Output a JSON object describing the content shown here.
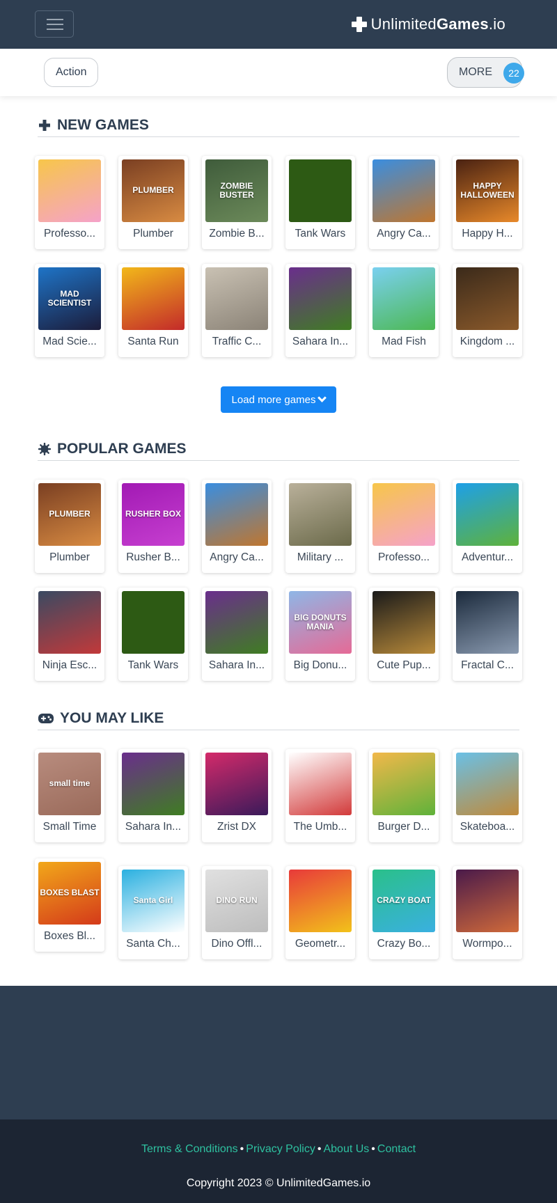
{
  "header": {
    "brand_light": "Unlimited",
    "brand_bold": "Games",
    "brand_suffix": ".io"
  },
  "categories": {
    "active": "Action",
    "more_label": "MORE",
    "more_count": "22"
  },
  "sections": [
    {
      "title": "NEW GAMES",
      "icon": "plus-icon",
      "games": [
        {
          "name": "Professo...",
          "thumb": [
            "#f7c64a",
            "#f5a2c9"
          ],
          "art": ""
        },
        {
          "name": "Plumber",
          "thumb": [
            "#7a3f22",
            "#d88b42"
          ],
          "art": "PLUMBER"
        },
        {
          "name": "Zombie B...",
          "thumb": [
            "#3f5c3b",
            "#6c8a5a"
          ],
          "art": "ZOMBIE BUSTER"
        },
        {
          "name": "Tank Wars",
          "thumb": [
            "#2d5a14",
            "#2d5a14"
          ],
          "art": ""
        },
        {
          "name": "Angry Ca...",
          "thumb": [
            "#3a8ee0",
            "#c0762e"
          ],
          "art": ""
        },
        {
          "name": "Happy H...",
          "thumb": [
            "#4a2212",
            "#e8892a"
          ],
          "art": "HAPPY HALLOWEEN"
        },
        {
          "name": "Mad Scie...",
          "thumb": [
            "#1e74c7",
            "#1c1c3a"
          ],
          "art": "MAD SCIENTIST"
        },
        {
          "name": "Santa Run",
          "thumb": [
            "#f2b81a",
            "#c32a2a"
          ],
          "art": ""
        },
        {
          "name": "Traffic C...",
          "thumb": [
            "#c9c1b3",
            "#8b8377"
          ],
          "art": ""
        },
        {
          "name": "Sahara In...",
          "thumb": [
            "#6a2e8c",
            "#3f7d22"
          ],
          "art": ""
        },
        {
          "name": "Mad Fish",
          "thumb": [
            "#7ad0f0",
            "#4cb852"
          ],
          "art": ""
        },
        {
          "name": "Kingdom ...",
          "thumb": [
            "#3b2a1a",
            "#8b5a2b"
          ],
          "art": ""
        }
      ]
    },
    {
      "title": "POPULAR GAMES",
      "icon": "sun-icon",
      "games": [
        {
          "name": "Plumber",
          "thumb": [
            "#7a3f22",
            "#d88b42"
          ],
          "art": "PLUMBER"
        },
        {
          "name": "Rusher B...",
          "thumb": [
            "#a21ab4",
            "#c63fd0"
          ],
          "art": "RUSHER BOX"
        },
        {
          "name": "Angry Ca...",
          "thumb": [
            "#3a8ee0",
            "#c0762e"
          ],
          "art": ""
        },
        {
          "name": "Military ...",
          "thumb": [
            "#b9b09a",
            "#6b6a4a"
          ],
          "art": ""
        },
        {
          "name": "Professo...",
          "thumb": [
            "#f7c64a",
            "#f5a2c9"
          ],
          "art": ""
        },
        {
          "name": "Adventur...",
          "thumb": [
            "#1ea0e8",
            "#5fb23a"
          ],
          "art": ""
        },
        {
          "name": "Ninja Esc...",
          "thumb": [
            "#3a4a62",
            "#c2393a"
          ],
          "art": ""
        },
        {
          "name": "Tank Wars",
          "thumb": [
            "#2d5a14",
            "#2d5a14"
          ],
          "art": ""
        },
        {
          "name": "Sahara In...",
          "thumb": [
            "#6a2e8c",
            "#3f7d22"
          ],
          "art": ""
        },
        {
          "name": "Big Donu...",
          "thumb": [
            "#8fb6e6",
            "#e56a96"
          ],
          "art": "BIG DONUTS MANIA"
        },
        {
          "name": "Cute Pup...",
          "thumb": [
            "#1a1a1a",
            "#b88a3a"
          ],
          "art": ""
        },
        {
          "name": "Fractal C...",
          "thumb": [
            "#1b2a3c",
            "#8a9ab0"
          ],
          "art": ""
        }
      ]
    },
    {
      "title": "YOU MAY LIKE",
      "icon": "gamepad-icon",
      "games": [
        {
          "name": "Small Time",
          "thumb": [
            "#b88c7e",
            "#9a6a5a"
          ],
          "art": "small time"
        },
        {
          "name": "Sahara In...",
          "thumb": [
            "#6a2e8c",
            "#3f7d22"
          ],
          "art": ""
        },
        {
          "name": "Zrist DX",
          "thumb": [
            "#d42a6a",
            "#3a1a5a"
          ],
          "art": ""
        },
        {
          "name": "The Umb...",
          "thumb": [
            "#ffffff",
            "#d23a3a"
          ],
          "art": ""
        },
        {
          "name": "Burger D...",
          "thumb": [
            "#f2b84a",
            "#5fb23a"
          ],
          "art": ""
        },
        {
          "name": "Skateboa...",
          "thumb": [
            "#6ac0e6",
            "#c08a3a"
          ],
          "art": ""
        },
        {
          "name": "Boxes Bl...",
          "thumb": [
            "#f2a81a",
            "#d43a1a"
          ],
          "art": "BOXES BLAST"
        },
        {
          "name": "Santa Ch...",
          "thumb": [
            "#2ab0e0",
            "#ffffff"
          ],
          "art": "Santa Girl"
        },
        {
          "name": "Dino Offl...",
          "thumb": [
            "#e0e0e0",
            "#bdbdbd"
          ],
          "art": "DINO RUN"
        },
        {
          "name": "Geometr...",
          "thumb": [
            "#e83a3a",
            "#f2c21a"
          ],
          "art": ""
        },
        {
          "name": "Crazy Bo...",
          "thumb": [
            "#2ac08a",
            "#3ab0e0"
          ],
          "art": "CRAZY BOAT"
        },
        {
          "name": "Wormpo...",
          "thumb": [
            "#4a1a4a",
            "#d06a3a"
          ],
          "art": ""
        }
      ]
    }
  ],
  "load_more_label": "Load more games",
  "footer": {
    "links": [
      "Terms & Conditions",
      "Privacy Policy",
      "About Us",
      "Contact"
    ],
    "copyright": "Copyright 2023 © UnlimitedGames.io"
  }
}
